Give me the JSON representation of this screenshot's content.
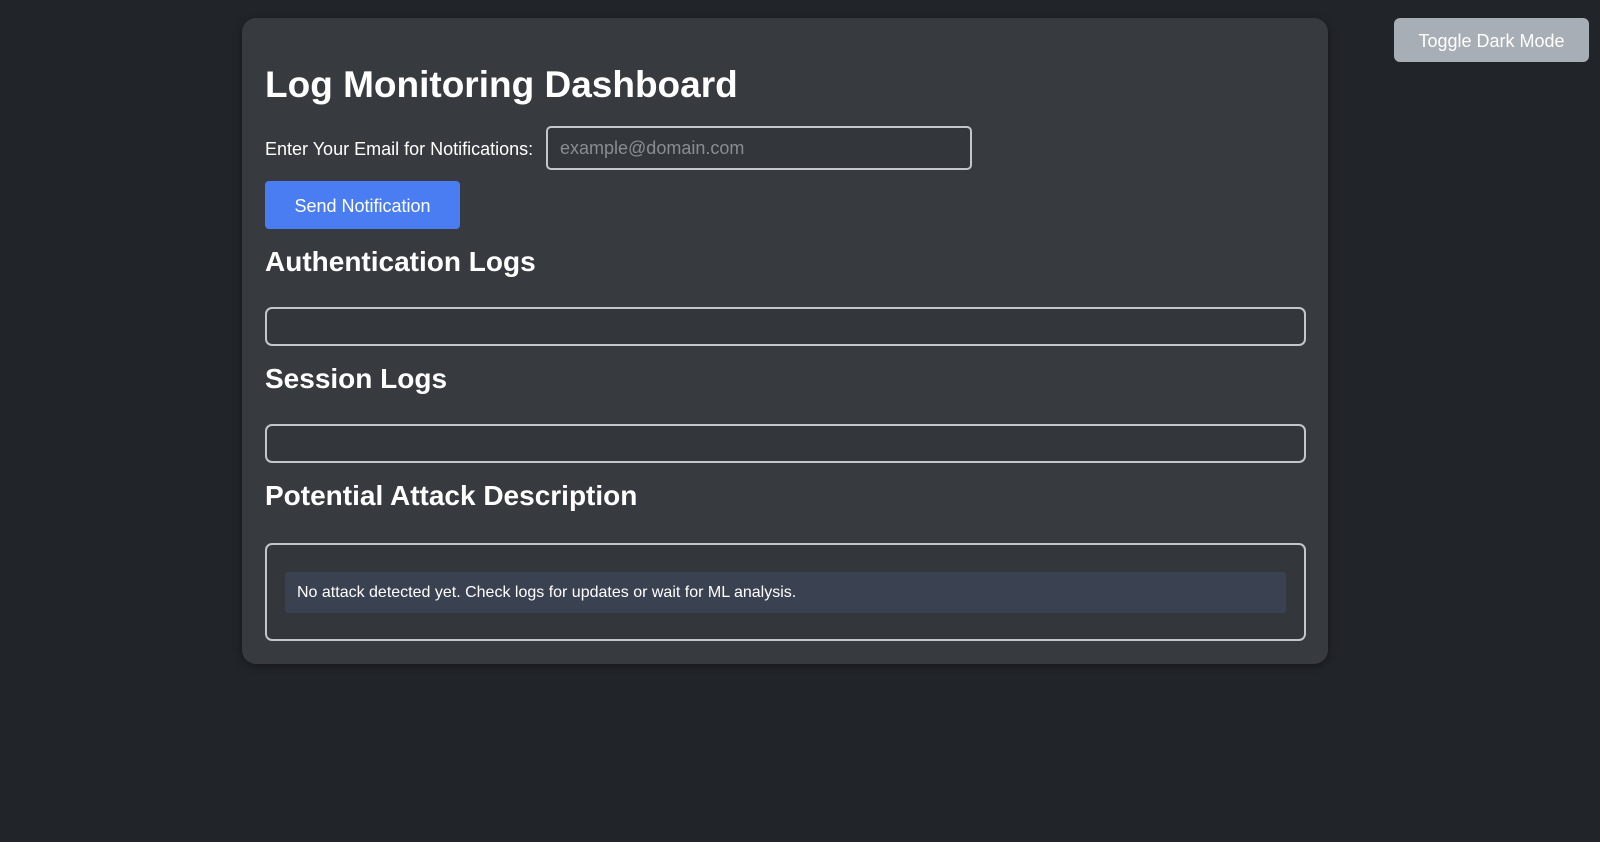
{
  "header": {
    "toggle_label": "Toggle Dark Mode"
  },
  "dashboard": {
    "title": "Log Monitoring Dashboard",
    "email": {
      "label": "Enter Your Email for Notifications:",
      "placeholder": "example@domain.com",
      "value": ""
    },
    "send_label": "Send Notification",
    "sections": {
      "auth": {
        "heading": "Authentication Logs",
        "content": ""
      },
      "session": {
        "heading": "Session Logs",
        "content": ""
      },
      "attack": {
        "heading": "Potential Attack Description",
        "message": "No attack detected yet. Check logs for updates or wait for ML analysis."
      }
    }
  },
  "colors": {
    "background": "#212429",
    "panel": "#373a3f",
    "accent": "#4a7df2",
    "toggle_button": "#a8aeb6",
    "message_bg": "#3a4150",
    "border": "#c3c6ca"
  }
}
